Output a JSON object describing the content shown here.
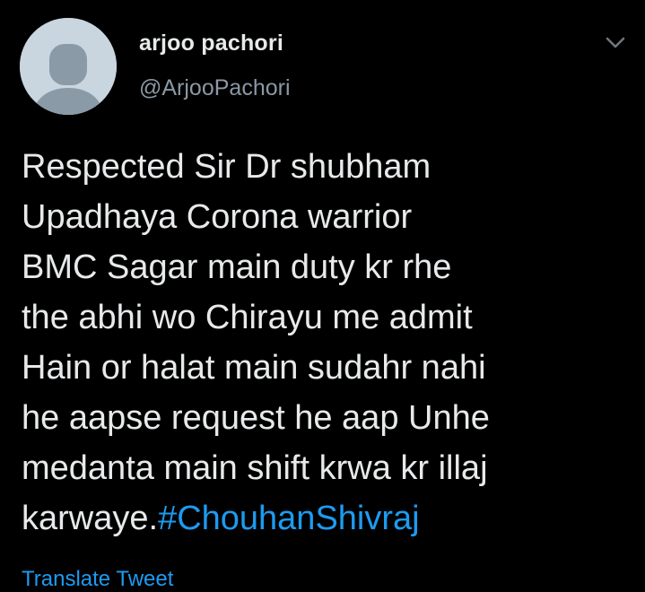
{
  "user": {
    "display_name": "arjoo pachori",
    "handle": "@ArjooPachori"
  },
  "tweet": {
    "text": "Respected Sir Dr shubham\nUpadhaya Corona warrior\nBMC Sagar main duty kr rhe\nthe abhi wo Chirayu me admit\nHain or halat main sudahr nahi\nhe aapse request he aap Unhe\nmedanta  main shift krwa kr illaj\nkarwaye.",
    "hashtag": "#ChouhanShivraj",
    "translate_label": "Translate Tweet"
  },
  "icons": {
    "avatar": "default-avatar-icon",
    "menu": "chevron-down-icon"
  },
  "colors": {
    "background": "#000000",
    "text": "#e7e9ea",
    "secondary_text": "#8b98a5",
    "link": "#1d9bf0",
    "avatar_bg": "#c9d5df",
    "avatar_figure": "#8a9aa7"
  }
}
